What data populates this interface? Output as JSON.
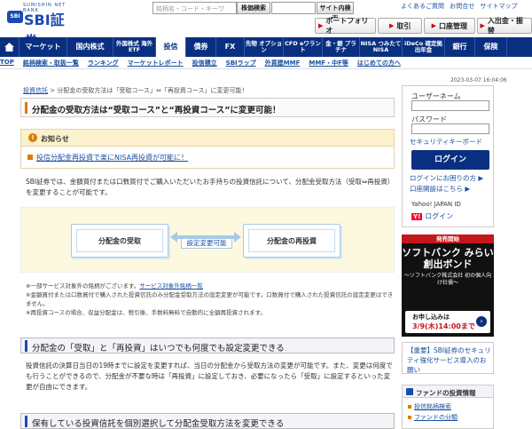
{
  "header": {
    "logo_small": "SUMISHIN NET BANK",
    "logo_mark": "SBI",
    "logo_text": "SBI証券",
    "search_placeholder": "銘柄名・コード・キーワ",
    "stock_search_label": "株価検索",
    "site_search_label": "サイト内検索",
    "util_links": [
      "よくあるご質問",
      "お問合せ",
      "サイトマップ"
    ],
    "util_buttons": [
      "ポートフォリオ",
      "取引",
      "口座管理",
      "入出金・振替"
    ]
  },
  "main_nav": [
    {
      "label": "マーケット",
      "small": false
    },
    {
      "label": "国内株式",
      "small": false
    },
    {
      "label": "外国株式 海外ETF",
      "small": true
    },
    {
      "label": "投信",
      "small": false,
      "active": true
    },
    {
      "label": "債券",
      "small": false
    },
    {
      "label": "FX",
      "small": false
    },
    {
      "label": "先物 オプション",
      "small": true
    },
    {
      "label": "CFD eワラント",
      "small": true
    },
    {
      "label": "金・銀 プラチナ",
      "small": true
    },
    {
      "label": "NISA つみたてNISA",
      "small": true
    },
    {
      "label": "iDeCo 確定拠出年金",
      "small": true
    },
    {
      "label": "銀行",
      "small": false
    },
    {
      "label": "保険",
      "small": false
    }
  ],
  "sub_nav": [
    "TOP",
    "銘柄検索・取扱一覧",
    "ランキング",
    "マーケットレポート",
    "投信積立",
    "SBIラップ",
    "外貨建MMF",
    "MMF・中F等",
    "はじめての方へ"
  ],
  "timestamp": "2023-03-07 16:04:06",
  "breadcrumb": {
    "link": "投資信託",
    "rest": " > 分配金の受取方法は「受取コース」⇔「再投資コース」に変更可能！"
  },
  "page_title": "分配金の受取方法は“受取コース”と“再投資コース”に変更可能！",
  "notice": {
    "title": "お知らせ",
    "item": "投信分配金再投資で楽にNISA再投資が可能に！"
  },
  "description": "SBI証券では、金額買付または口数買付でご購入いただいたお手持ちの投資信託について、分配金受取方法（受取⇔再投資）を変更することが可能です。",
  "diagram": {
    "left": "分配金の受取",
    "right": "分配金の再投資",
    "arrow_label": "設定変更可能"
  },
  "notes": [
    {
      "text": "※一部サービス対象外の銘柄がございます。",
      "link": "サービス対象外銘柄一覧"
    },
    {
      "text": "※金額買付または口数買付で購入された投資信託のみ分配金受取方法の設定変更が可能です。口数買付で購入された投資信託の設定変更はできません。",
      "link": ""
    },
    {
      "text": "※再投資コースの場合、収益分配金は、税引後、手数料無料で自動的に全額再投資されます。",
      "link": ""
    }
  ],
  "section1": {
    "title": "分配金の「受取」と「再投資」はいつでも何度でも設定変更できる",
    "text": "投資信託の決算日当日の19時までに設定を変更すれば、当日の分配金から受取方法の変更が可能です。また、変更は何度でも行うことができるので、分配金が不要な時は「再投資」に設定しておき、必要になったら「受取」に設定するといった変更が自由にできます。"
  },
  "section2": {
    "title": "保有している投資信託を個別選択して分配金受取方法を変更できる"
  },
  "login": {
    "username_label": "ユーザーネーム",
    "password_label": "パスワード",
    "security_keyboard": "セキュリティキーボード",
    "login_button": "ログイン",
    "forgot_link": "ログインにお困りの方 ▶",
    "open_account_link": "口座開設はこちら ▶",
    "yahoo_label": "Yahoo! JAPAN ID",
    "yahoo_login": "ログイン"
  },
  "bond_banner": {
    "top": "発売開始",
    "title": "ソフトバンク みらい創出ボンド",
    "sub": "〜ソフトバンク株式会社 初の個人向け社債〜",
    "apply": "お申し込みは",
    "date": "3/9(木)14:00まで"
  },
  "promo": "【重要】SBI証券のセキュリティ強化サービス導入のお願い",
  "fund_info": {
    "title": "ファンドの投資情報",
    "links": [
      "投信銘柄検索",
      "ファンドの分類"
    ]
  },
  "colors": {
    "brand_navy": "#0a2f80",
    "accent_orange": "#e07b00",
    "link_blue": "#1a4fa0"
  }
}
